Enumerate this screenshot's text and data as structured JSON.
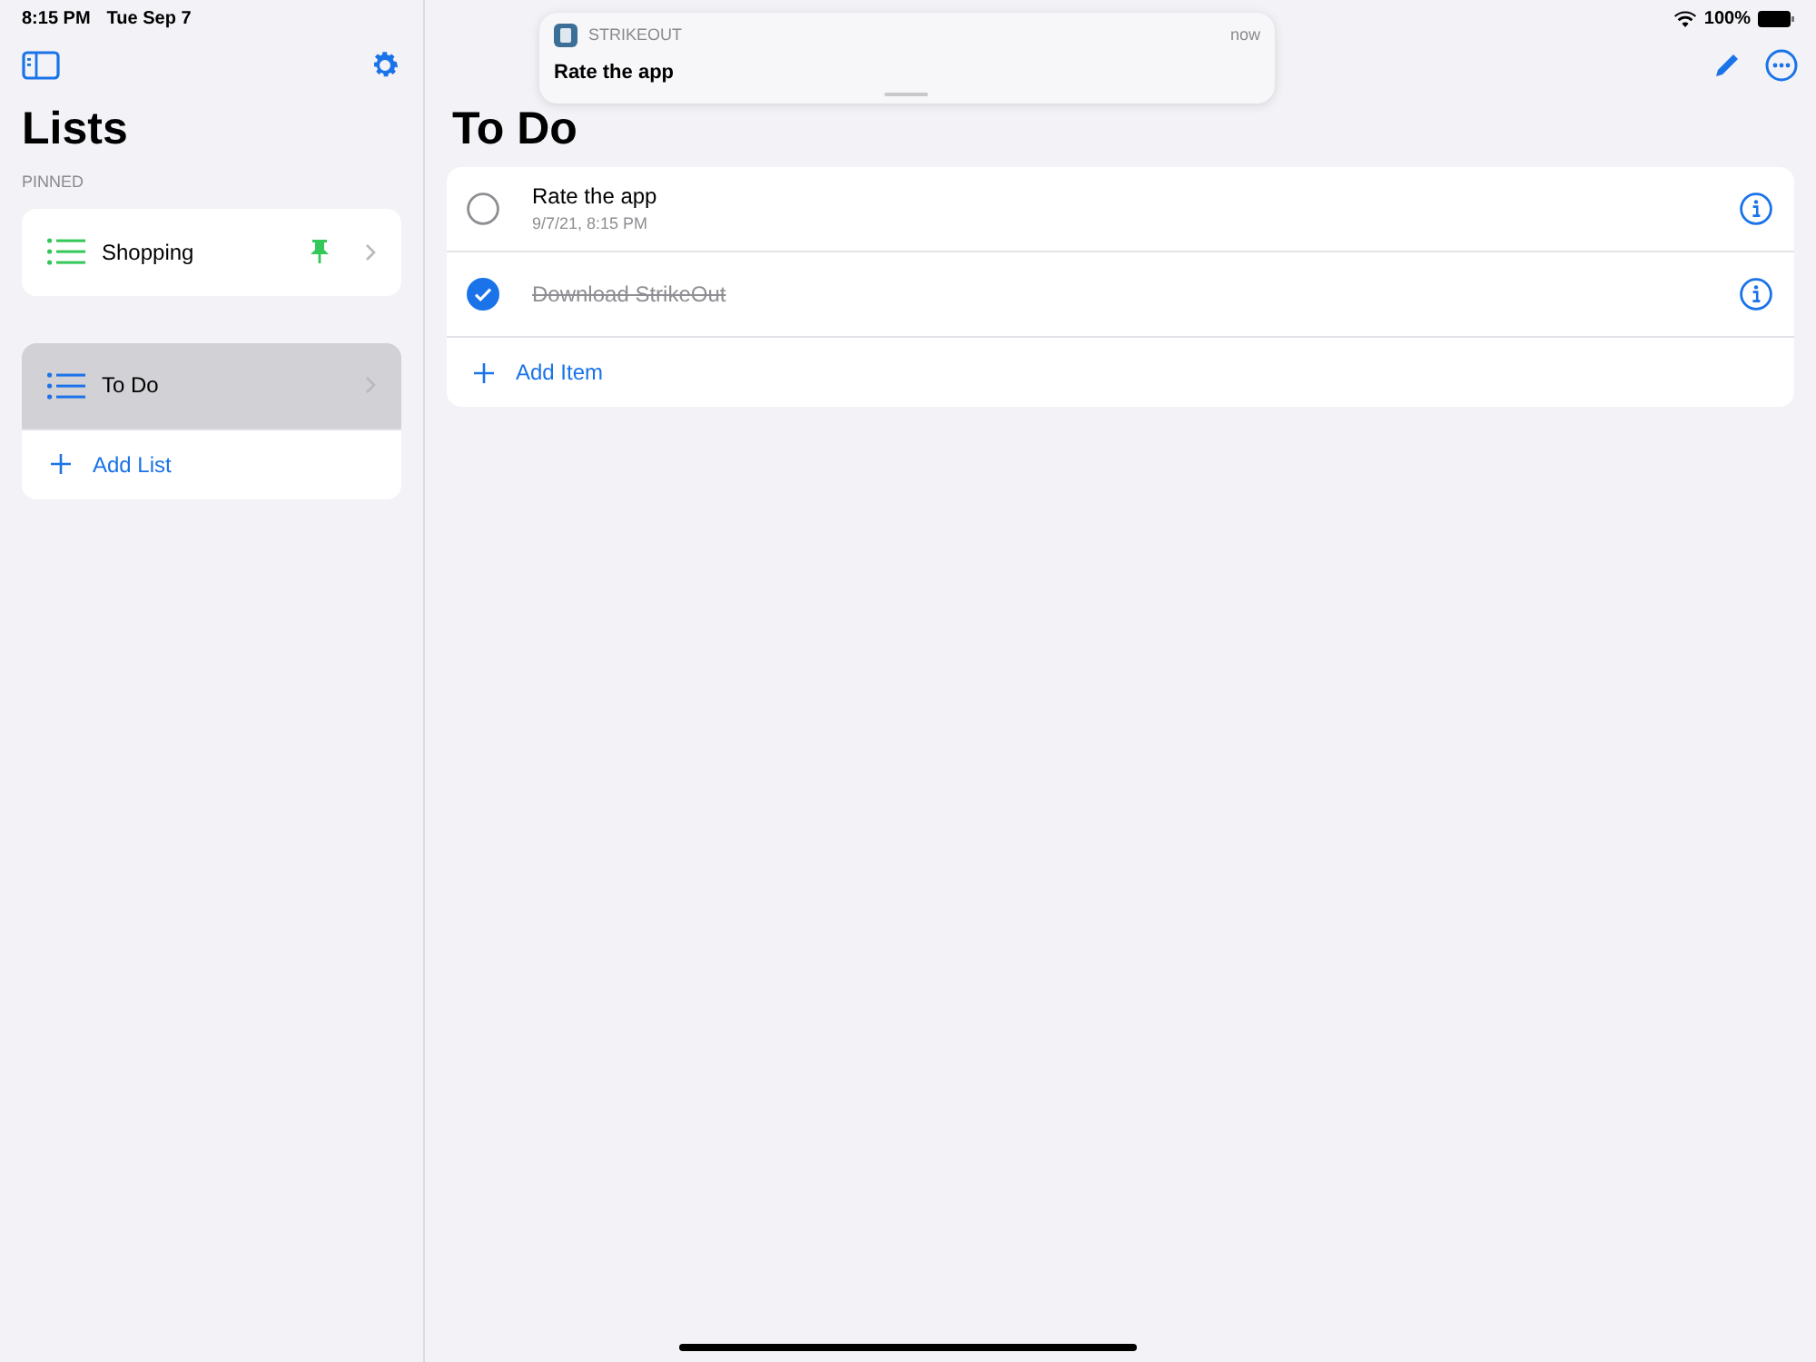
{
  "status_bar": {
    "time": "8:15 PM",
    "date": "Tue Sep 7",
    "battery": "100%"
  },
  "sidebar": {
    "title": "Lists",
    "pinned_header": "PINNED",
    "pinned": [
      {
        "name": "Shopping",
        "color": "#34c759",
        "pinned": true,
        "selected": false
      }
    ],
    "lists": [
      {
        "name": "To Do",
        "color": "#1a73e8",
        "pinned": false,
        "selected": true
      }
    ],
    "add_list": "Add List"
  },
  "main": {
    "title": "To Do",
    "items": [
      {
        "title": "Rate the app",
        "subtitle": "9/7/21, 8:15 PM",
        "checked": false
      },
      {
        "title": "Download StrikeOut",
        "checked": true
      }
    ],
    "add_item": "Add Item"
  },
  "notification": {
    "app": "STRIKEOUT",
    "time": "now",
    "message": "Rate the app"
  }
}
